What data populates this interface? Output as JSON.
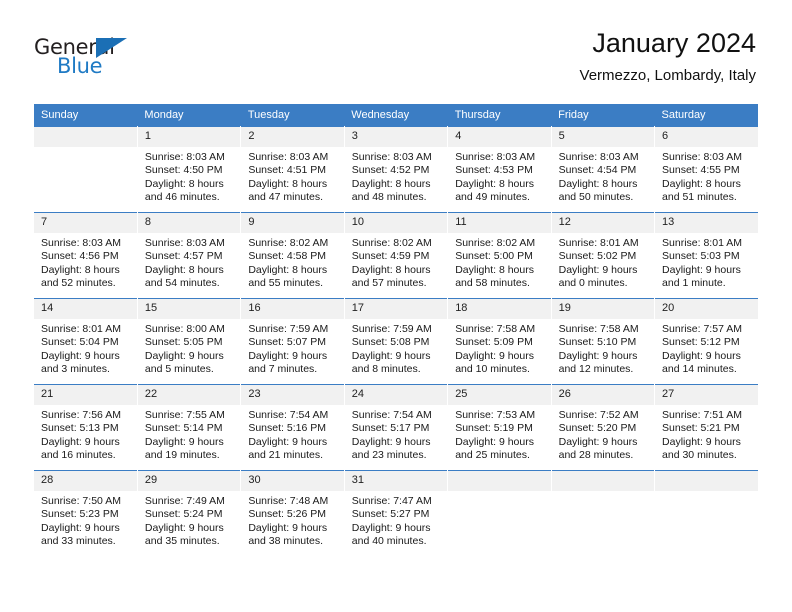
{
  "brand": {
    "word_one": "General",
    "word_two": "Blue",
    "triangle_color": "#1b6fb5",
    "blue_text_color": "#1f7ac4"
  },
  "header": {
    "title": "January 2024",
    "subtitle": "Vermezzo, Lombardy, Italy"
  },
  "theme": {
    "header_blue": "#3b7dc4",
    "daynum_gray": "#f1f1f1"
  },
  "weekday_headers": [
    "Sunday",
    "Monday",
    "Tuesday",
    "Wednesday",
    "Thursday",
    "Friday",
    "Saturday"
  ],
  "weeks": [
    [
      {
        "day": "",
        "sunrise": "",
        "sunset": "",
        "daylight1": "",
        "daylight2": ""
      },
      {
        "day": "1",
        "sunrise": "Sunrise: 8:03 AM",
        "sunset": "Sunset: 4:50 PM",
        "daylight1": "Daylight: 8 hours",
        "daylight2": "and 46 minutes."
      },
      {
        "day": "2",
        "sunrise": "Sunrise: 8:03 AM",
        "sunset": "Sunset: 4:51 PM",
        "daylight1": "Daylight: 8 hours",
        "daylight2": "and 47 minutes."
      },
      {
        "day": "3",
        "sunrise": "Sunrise: 8:03 AM",
        "sunset": "Sunset: 4:52 PM",
        "daylight1": "Daylight: 8 hours",
        "daylight2": "and 48 minutes."
      },
      {
        "day": "4",
        "sunrise": "Sunrise: 8:03 AM",
        "sunset": "Sunset: 4:53 PM",
        "daylight1": "Daylight: 8 hours",
        "daylight2": "and 49 minutes."
      },
      {
        "day": "5",
        "sunrise": "Sunrise: 8:03 AM",
        "sunset": "Sunset: 4:54 PM",
        "daylight1": "Daylight: 8 hours",
        "daylight2": "and 50 minutes."
      },
      {
        "day": "6",
        "sunrise": "Sunrise: 8:03 AM",
        "sunset": "Sunset: 4:55 PM",
        "daylight1": "Daylight: 8 hours",
        "daylight2": "and 51 minutes."
      }
    ],
    [
      {
        "day": "7",
        "sunrise": "Sunrise: 8:03 AM",
        "sunset": "Sunset: 4:56 PM",
        "daylight1": "Daylight: 8 hours",
        "daylight2": "and 52 minutes."
      },
      {
        "day": "8",
        "sunrise": "Sunrise: 8:03 AM",
        "sunset": "Sunset: 4:57 PM",
        "daylight1": "Daylight: 8 hours",
        "daylight2": "and 54 minutes."
      },
      {
        "day": "9",
        "sunrise": "Sunrise: 8:02 AM",
        "sunset": "Sunset: 4:58 PM",
        "daylight1": "Daylight: 8 hours",
        "daylight2": "and 55 minutes."
      },
      {
        "day": "10",
        "sunrise": "Sunrise: 8:02 AM",
        "sunset": "Sunset: 4:59 PM",
        "daylight1": "Daylight: 8 hours",
        "daylight2": "and 57 minutes."
      },
      {
        "day": "11",
        "sunrise": "Sunrise: 8:02 AM",
        "sunset": "Sunset: 5:00 PM",
        "daylight1": "Daylight: 8 hours",
        "daylight2": "and 58 minutes."
      },
      {
        "day": "12",
        "sunrise": "Sunrise: 8:01 AM",
        "sunset": "Sunset: 5:02 PM",
        "daylight1": "Daylight: 9 hours",
        "daylight2": "and 0 minutes."
      },
      {
        "day": "13",
        "sunrise": "Sunrise: 8:01 AM",
        "sunset": "Sunset: 5:03 PM",
        "daylight1": "Daylight: 9 hours",
        "daylight2": "and 1 minute."
      }
    ],
    [
      {
        "day": "14",
        "sunrise": "Sunrise: 8:01 AM",
        "sunset": "Sunset: 5:04 PM",
        "daylight1": "Daylight: 9 hours",
        "daylight2": "and 3 minutes."
      },
      {
        "day": "15",
        "sunrise": "Sunrise: 8:00 AM",
        "sunset": "Sunset: 5:05 PM",
        "daylight1": "Daylight: 9 hours",
        "daylight2": "and 5 minutes."
      },
      {
        "day": "16",
        "sunrise": "Sunrise: 7:59 AM",
        "sunset": "Sunset: 5:07 PM",
        "daylight1": "Daylight: 9 hours",
        "daylight2": "and 7 minutes."
      },
      {
        "day": "17",
        "sunrise": "Sunrise: 7:59 AM",
        "sunset": "Sunset: 5:08 PM",
        "daylight1": "Daylight: 9 hours",
        "daylight2": "and 8 minutes."
      },
      {
        "day": "18",
        "sunrise": "Sunrise: 7:58 AM",
        "sunset": "Sunset: 5:09 PM",
        "daylight1": "Daylight: 9 hours",
        "daylight2": "and 10 minutes."
      },
      {
        "day": "19",
        "sunrise": "Sunrise: 7:58 AM",
        "sunset": "Sunset: 5:10 PM",
        "daylight1": "Daylight: 9 hours",
        "daylight2": "and 12 minutes."
      },
      {
        "day": "20",
        "sunrise": "Sunrise: 7:57 AM",
        "sunset": "Sunset: 5:12 PM",
        "daylight1": "Daylight: 9 hours",
        "daylight2": "and 14 minutes."
      }
    ],
    [
      {
        "day": "21",
        "sunrise": "Sunrise: 7:56 AM",
        "sunset": "Sunset: 5:13 PM",
        "daylight1": "Daylight: 9 hours",
        "daylight2": "and 16 minutes."
      },
      {
        "day": "22",
        "sunrise": "Sunrise: 7:55 AM",
        "sunset": "Sunset: 5:14 PM",
        "daylight1": "Daylight: 9 hours",
        "daylight2": "and 19 minutes."
      },
      {
        "day": "23",
        "sunrise": "Sunrise: 7:54 AM",
        "sunset": "Sunset: 5:16 PM",
        "daylight1": "Daylight: 9 hours",
        "daylight2": "and 21 minutes."
      },
      {
        "day": "24",
        "sunrise": "Sunrise: 7:54 AM",
        "sunset": "Sunset: 5:17 PM",
        "daylight1": "Daylight: 9 hours",
        "daylight2": "and 23 minutes."
      },
      {
        "day": "25",
        "sunrise": "Sunrise: 7:53 AM",
        "sunset": "Sunset: 5:19 PM",
        "daylight1": "Daylight: 9 hours",
        "daylight2": "and 25 minutes."
      },
      {
        "day": "26",
        "sunrise": "Sunrise: 7:52 AM",
        "sunset": "Sunset: 5:20 PM",
        "daylight1": "Daylight: 9 hours",
        "daylight2": "and 28 minutes."
      },
      {
        "day": "27",
        "sunrise": "Sunrise: 7:51 AM",
        "sunset": "Sunset: 5:21 PM",
        "daylight1": "Daylight: 9 hours",
        "daylight2": "and 30 minutes."
      }
    ],
    [
      {
        "day": "28",
        "sunrise": "Sunrise: 7:50 AM",
        "sunset": "Sunset: 5:23 PM",
        "daylight1": "Daylight: 9 hours",
        "daylight2": "and 33 minutes."
      },
      {
        "day": "29",
        "sunrise": "Sunrise: 7:49 AM",
        "sunset": "Sunset: 5:24 PM",
        "daylight1": "Daylight: 9 hours",
        "daylight2": "and 35 minutes."
      },
      {
        "day": "30",
        "sunrise": "Sunrise: 7:48 AM",
        "sunset": "Sunset: 5:26 PM",
        "daylight1": "Daylight: 9 hours",
        "daylight2": "and 38 minutes."
      },
      {
        "day": "31",
        "sunrise": "Sunrise: 7:47 AM",
        "sunset": "Sunset: 5:27 PM",
        "daylight1": "Daylight: 9 hours",
        "daylight2": "and 40 minutes."
      },
      {
        "day": "",
        "sunrise": "",
        "sunset": "",
        "daylight1": "",
        "daylight2": ""
      },
      {
        "day": "",
        "sunrise": "",
        "sunset": "",
        "daylight1": "",
        "daylight2": ""
      },
      {
        "day": "",
        "sunrise": "",
        "sunset": "",
        "daylight1": "",
        "daylight2": ""
      }
    ]
  ]
}
